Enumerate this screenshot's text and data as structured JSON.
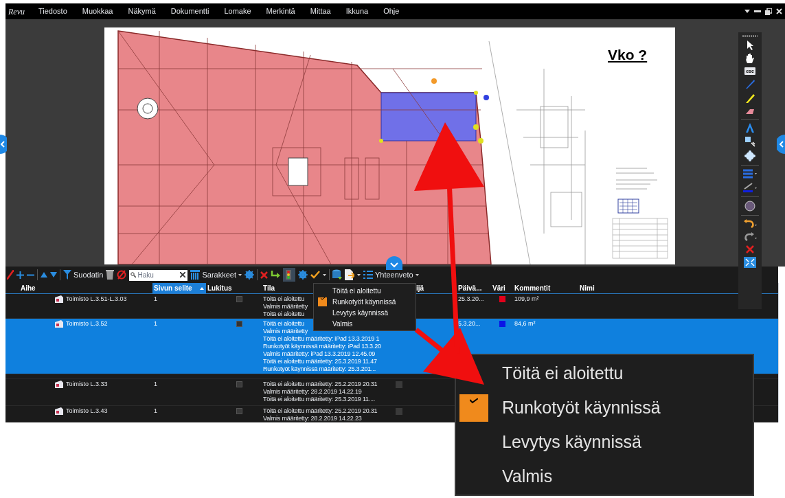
{
  "app": {
    "logo": "Revu"
  },
  "menu": [
    "Tiedosto",
    "Muokkaa",
    "Näkymä",
    "Dokumentti",
    "Lomake",
    "Merkintä",
    "Mittaa",
    "Ikkuna",
    "Ohje"
  ],
  "drawing": {
    "title": "Vko ?"
  },
  "tools": {
    "esc_label": "esc"
  },
  "markups_toolbar": {
    "filter_label": "Suodatin",
    "search": {
      "placeholder": "Haku"
    },
    "columns_label": "Sarakkeet",
    "summary_label": "Yhteenveto"
  },
  "table": {
    "columns": [
      {
        "label": "Aihe",
        "selected": false
      },
      {
        "label": "Sivun selite",
        "selected": true
      },
      {
        "label": "Lukitus",
        "selected": false
      },
      {
        "label": "Tila",
        "selected": false
      },
      {
        "label": "ijä",
        "selected": false
      },
      {
        "label": "Päivä...",
        "selected": false
      },
      {
        "label": "Väri",
        "selected": false
      },
      {
        "label": "Kommentit",
        "selected": false
      },
      {
        "label": "Nimi",
        "selected": false
      }
    ],
    "rows": [
      {
        "subject": "Toimisto L.3.51-L.3.03",
        "page_label": "1",
        "locked": false,
        "selected": false,
        "status_lines": [
          "Töitä ei aloitettu",
          "Valmis määritetty",
          "Töitä ei aloitettu"
        ],
        "date": "25.3.20...",
        "color": "#e3001b",
        "comment": "109,9 m²"
      },
      {
        "subject": "Toimisto L.3.52",
        "page_label": "1",
        "locked": false,
        "selected": true,
        "status_lines": [
          "Töitä ei aloitettu",
          "Valmis määritetty",
          "Töitä ei aloitettu määritetty: iPad 13.3.2019 1",
          "Runkotyöt käynnissä määritetty: iPad 13.3.20",
          "Valmis määritetty: iPad 13.3.2019 12.45.09",
          "Töitä ei aloitettu määritetty:  25.3.2019 11.47",
          "Runkotyöt käynnissä määritetty:  25.3.201..."
        ],
        "date": "5.3.20...",
        "color": "#0a14e6",
        "comment": "84,6 m²"
      },
      {
        "subject": "Toimisto L.3.33",
        "page_label": "1",
        "locked": false,
        "selected": false,
        "mark_box": false,
        "status_lines": [
          "Töitä ei aloitettu määritetty:  25.2.2019 20.31",
          "Valmis määritetty:  28.2.2019 14.22.19",
          "Töitä ei aloitettu määritetty:  25.3.2019 11...."
        ]
      },
      {
        "subject": "Toimisto L.3.43",
        "page_label": "1",
        "locked": false,
        "selected": false,
        "mark_box": false,
        "status_lines": [
          "Töitä ei aloitettu määritetty:  25.2.2019 20.31",
          "Valmis määritetty:  28.2.2019 14.22.23"
        ]
      }
    ]
  },
  "status_menu": {
    "items": [
      {
        "label": "Töitä ei aloitettu",
        "checked": false
      },
      {
        "label": "Runkotyöt käynnissä",
        "checked": true
      },
      {
        "label": "Levytys käynnissä",
        "checked": false
      },
      {
        "label": "Valmis",
        "checked": false
      }
    ]
  },
  "callout": {
    "items": [
      {
        "label": "Töitä ei aloitettu",
        "checked": false
      },
      {
        "label": "Runkotyöt käynnissä",
        "checked": true
      },
      {
        "label": "Levytys käynnissä",
        "checked": false
      },
      {
        "label": "Valmis",
        "checked": false
      }
    ]
  }
}
